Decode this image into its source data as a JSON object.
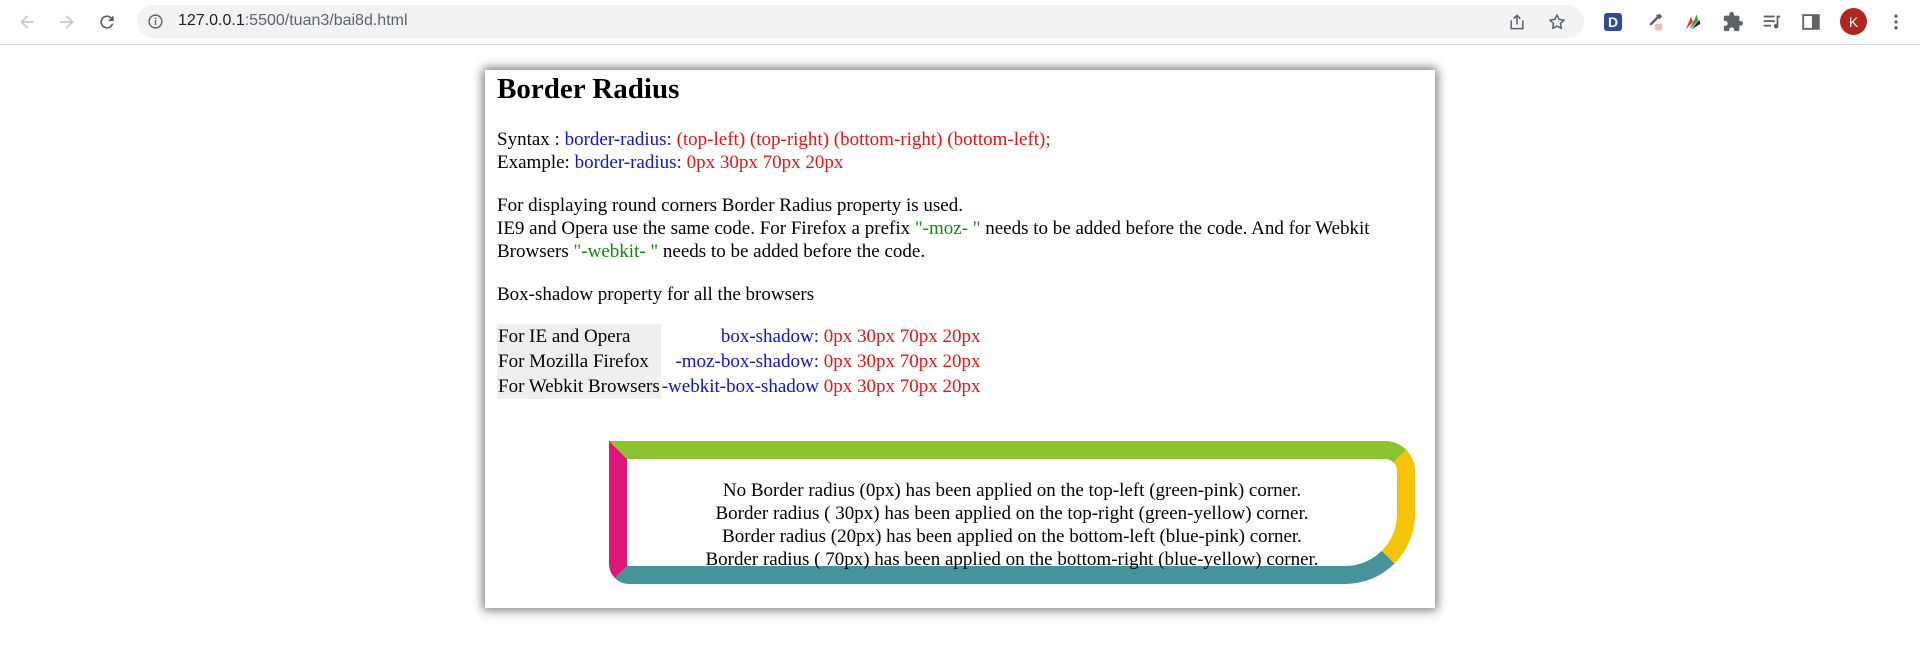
{
  "browser": {
    "url_host": "127.0.0.1",
    "url_path": ":5500/tuan3/bai8d.html",
    "avatar_letter": "K",
    "extension_d_label": "D"
  },
  "page": {
    "title": "Border Radius",
    "syntax": {
      "label": "Syntax : ",
      "property": "border-radius:",
      "value": " (top-left) (top-right) (bottom-right) (bottom-left);"
    },
    "example": {
      "label": "Example: ",
      "property": "border-radius:",
      "value": " 0px 30px 70px 20px"
    },
    "intro": "For displaying round corners Border Radius property is used.",
    "prefix_text_1": "IE9 and Opera use the same code. For Firefox a prefix ",
    "moz_prefix": "\"-moz- \"",
    "prefix_text_2": " needs to be added before the code. And for Webkit Browsers ",
    "webkit_prefix": "\"-webkit- \"",
    "prefix_text_3": " needs to be added before the code.",
    "box_shadow_heading": "Box-shadow property for all the browsers",
    "shadow_table": [
      {
        "label": "For IE and Opera",
        "property": "box-shadow:",
        "value": " 0px 30px 70px 20px"
      },
      {
        "label": "For Mozilla Firefox",
        "property": "-moz-box-shadow:",
        "value": " 0px 30px 70px 20px"
      },
      {
        "label": "For Webkit Browsers",
        "property": "-webkit-box-shadow",
        "value": " 0px 30px 70px 20px"
      }
    ],
    "demo_lines": [
      "No Border radius (0px) has been applied on the top-left (green-pink) corner.",
      "Border radius ( 30px) has been applied on the top-right (green-yellow) corner.",
      "Border radius (20px) has been applied on the bottom-left (blue-pink) corner.",
      "Border radius ( 70px) has been applied on the bottom-right (blue-yellow) corner."
    ]
  },
  "colors": {
    "property_blue": "#1010dd",
    "value_red": "#ee1111",
    "prefix_green": "#118811",
    "border_top": "#8cc22e",
    "border_right": "#f5c30a",
    "border_bottom": "#46939c",
    "border_left": "#e01579"
  }
}
